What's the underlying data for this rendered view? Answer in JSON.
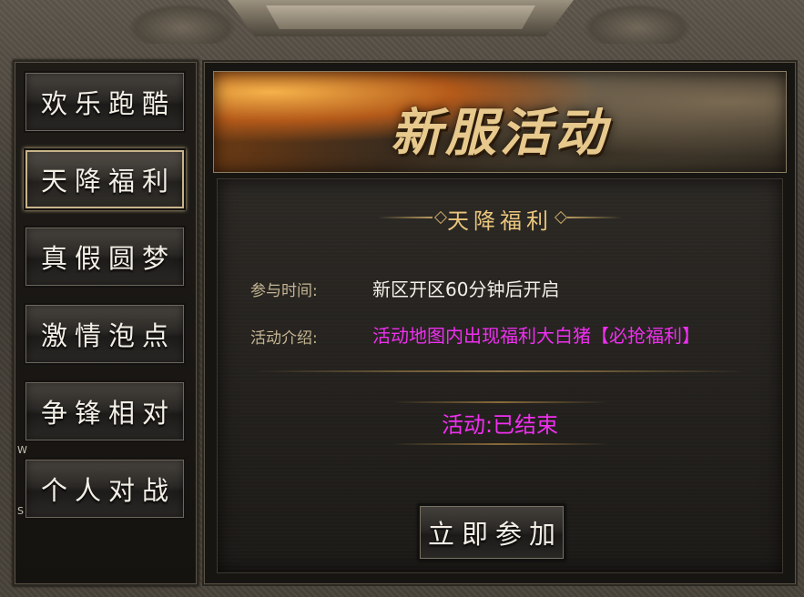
{
  "sidebar": {
    "items": [
      {
        "label": "欢乐跑酷"
      },
      {
        "label": "天降福利"
      },
      {
        "label": "真假圆梦"
      },
      {
        "label": "激情泡点"
      },
      {
        "label": "争锋相对"
      },
      {
        "label": "个人对战"
      }
    ],
    "active_index": 1,
    "marker_w": "W",
    "marker_s": "S"
  },
  "banner": {
    "title": "新服活动"
  },
  "content": {
    "section_title": "天降福利",
    "time_label": "参与时间:",
    "time_value": "新区开区60分钟后开启",
    "intro_label": "活动介绍:",
    "intro_value": "活动地图内出现福利大白猪【必抢福利】",
    "status": "活动:已结束",
    "join_button": "立即参加"
  },
  "colors": {
    "accent_gold": "#e9c67c",
    "highlight_magenta": "#ef2ff0"
  }
}
